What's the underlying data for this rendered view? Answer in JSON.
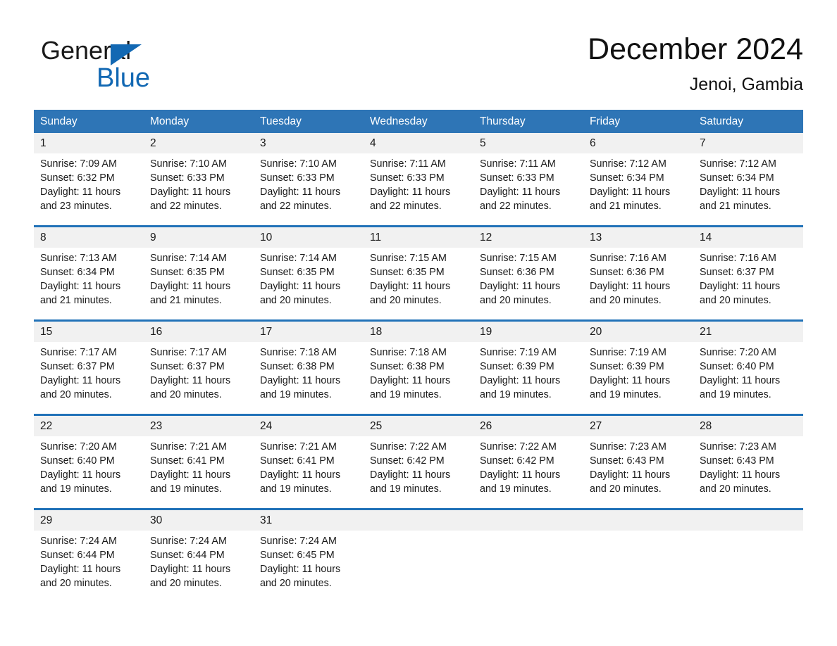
{
  "brand": {
    "name_part1": "General",
    "name_part2": "Blue",
    "triangle_color": "#1268b3",
    "text_color": "#1a1a1a"
  },
  "header": {
    "month_title": "December 2024",
    "location": "Jenoi, Gambia"
  },
  "theme": {
    "header_blue": "#2e75b6",
    "row_separator_blue": "#2172b8",
    "day_number_band": "#f1f1f1",
    "page_background": "#ffffff"
  },
  "calendar": {
    "weekdays": [
      "Sunday",
      "Monday",
      "Tuesday",
      "Wednesday",
      "Thursday",
      "Friday",
      "Saturday"
    ],
    "weeks": [
      [
        {
          "day": "1",
          "sunrise": "Sunrise: 7:09 AM",
          "sunset": "Sunset: 6:32 PM",
          "daylight": "Daylight: 11 hours and 23 minutes."
        },
        {
          "day": "2",
          "sunrise": "Sunrise: 7:10 AM",
          "sunset": "Sunset: 6:33 PM",
          "daylight": "Daylight: 11 hours and 22 minutes."
        },
        {
          "day": "3",
          "sunrise": "Sunrise: 7:10 AM",
          "sunset": "Sunset: 6:33 PM",
          "daylight": "Daylight: 11 hours and 22 minutes."
        },
        {
          "day": "4",
          "sunrise": "Sunrise: 7:11 AM",
          "sunset": "Sunset: 6:33 PM",
          "daylight": "Daylight: 11 hours and 22 minutes."
        },
        {
          "day": "5",
          "sunrise": "Sunrise: 7:11 AM",
          "sunset": "Sunset: 6:33 PM",
          "daylight": "Daylight: 11 hours and 22 minutes."
        },
        {
          "day": "6",
          "sunrise": "Sunrise: 7:12 AM",
          "sunset": "Sunset: 6:34 PM",
          "daylight": "Daylight: 11 hours and 21 minutes."
        },
        {
          "day": "7",
          "sunrise": "Sunrise: 7:12 AM",
          "sunset": "Sunset: 6:34 PM",
          "daylight": "Daylight: 11 hours and 21 minutes."
        }
      ],
      [
        {
          "day": "8",
          "sunrise": "Sunrise: 7:13 AM",
          "sunset": "Sunset: 6:34 PM",
          "daylight": "Daylight: 11 hours and 21 minutes."
        },
        {
          "day": "9",
          "sunrise": "Sunrise: 7:14 AM",
          "sunset": "Sunset: 6:35 PM",
          "daylight": "Daylight: 11 hours and 21 minutes."
        },
        {
          "day": "10",
          "sunrise": "Sunrise: 7:14 AM",
          "sunset": "Sunset: 6:35 PM",
          "daylight": "Daylight: 11 hours and 20 minutes."
        },
        {
          "day": "11",
          "sunrise": "Sunrise: 7:15 AM",
          "sunset": "Sunset: 6:35 PM",
          "daylight": "Daylight: 11 hours and 20 minutes."
        },
        {
          "day": "12",
          "sunrise": "Sunrise: 7:15 AM",
          "sunset": "Sunset: 6:36 PM",
          "daylight": "Daylight: 11 hours and 20 minutes."
        },
        {
          "day": "13",
          "sunrise": "Sunrise: 7:16 AM",
          "sunset": "Sunset: 6:36 PM",
          "daylight": "Daylight: 11 hours and 20 minutes."
        },
        {
          "day": "14",
          "sunrise": "Sunrise: 7:16 AM",
          "sunset": "Sunset: 6:37 PM",
          "daylight": "Daylight: 11 hours and 20 minutes."
        }
      ],
      [
        {
          "day": "15",
          "sunrise": "Sunrise: 7:17 AM",
          "sunset": "Sunset: 6:37 PM",
          "daylight": "Daylight: 11 hours and 20 minutes."
        },
        {
          "day": "16",
          "sunrise": "Sunrise: 7:17 AM",
          "sunset": "Sunset: 6:37 PM",
          "daylight": "Daylight: 11 hours and 20 minutes."
        },
        {
          "day": "17",
          "sunrise": "Sunrise: 7:18 AM",
          "sunset": "Sunset: 6:38 PM",
          "daylight": "Daylight: 11 hours and 19 minutes."
        },
        {
          "day": "18",
          "sunrise": "Sunrise: 7:18 AM",
          "sunset": "Sunset: 6:38 PM",
          "daylight": "Daylight: 11 hours and 19 minutes."
        },
        {
          "day": "19",
          "sunrise": "Sunrise: 7:19 AM",
          "sunset": "Sunset: 6:39 PM",
          "daylight": "Daylight: 11 hours and 19 minutes."
        },
        {
          "day": "20",
          "sunrise": "Sunrise: 7:19 AM",
          "sunset": "Sunset: 6:39 PM",
          "daylight": "Daylight: 11 hours and 19 minutes."
        },
        {
          "day": "21",
          "sunrise": "Sunrise: 7:20 AM",
          "sunset": "Sunset: 6:40 PM",
          "daylight": "Daylight: 11 hours and 19 minutes."
        }
      ],
      [
        {
          "day": "22",
          "sunrise": "Sunrise: 7:20 AM",
          "sunset": "Sunset: 6:40 PM",
          "daylight": "Daylight: 11 hours and 19 minutes."
        },
        {
          "day": "23",
          "sunrise": "Sunrise: 7:21 AM",
          "sunset": "Sunset: 6:41 PM",
          "daylight": "Daylight: 11 hours and 19 minutes."
        },
        {
          "day": "24",
          "sunrise": "Sunrise: 7:21 AM",
          "sunset": "Sunset: 6:41 PM",
          "daylight": "Daylight: 11 hours and 19 minutes."
        },
        {
          "day": "25",
          "sunrise": "Sunrise: 7:22 AM",
          "sunset": "Sunset: 6:42 PM",
          "daylight": "Daylight: 11 hours and 19 minutes."
        },
        {
          "day": "26",
          "sunrise": "Sunrise: 7:22 AM",
          "sunset": "Sunset: 6:42 PM",
          "daylight": "Daylight: 11 hours and 19 minutes."
        },
        {
          "day": "27",
          "sunrise": "Sunrise: 7:23 AM",
          "sunset": "Sunset: 6:43 PM",
          "daylight": "Daylight: 11 hours and 20 minutes."
        },
        {
          "day": "28",
          "sunrise": "Sunrise: 7:23 AM",
          "sunset": "Sunset: 6:43 PM",
          "daylight": "Daylight: 11 hours and 20 minutes."
        }
      ],
      [
        {
          "day": "29",
          "sunrise": "Sunrise: 7:24 AM",
          "sunset": "Sunset: 6:44 PM",
          "daylight": "Daylight: 11 hours and 20 minutes."
        },
        {
          "day": "30",
          "sunrise": "Sunrise: 7:24 AM",
          "sunset": "Sunset: 6:44 PM",
          "daylight": "Daylight: 11 hours and 20 minutes."
        },
        {
          "day": "31",
          "sunrise": "Sunrise: 7:24 AM",
          "sunset": "Sunset: 6:45 PM",
          "daylight": "Daylight: 11 hours and 20 minutes."
        },
        {
          "day": "",
          "sunrise": "",
          "sunset": "",
          "daylight": ""
        },
        {
          "day": "",
          "sunrise": "",
          "sunset": "",
          "daylight": ""
        },
        {
          "day": "",
          "sunrise": "",
          "sunset": "",
          "daylight": ""
        },
        {
          "day": "",
          "sunrise": "",
          "sunset": "",
          "daylight": ""
        }
      ]
    ]
  }
}
